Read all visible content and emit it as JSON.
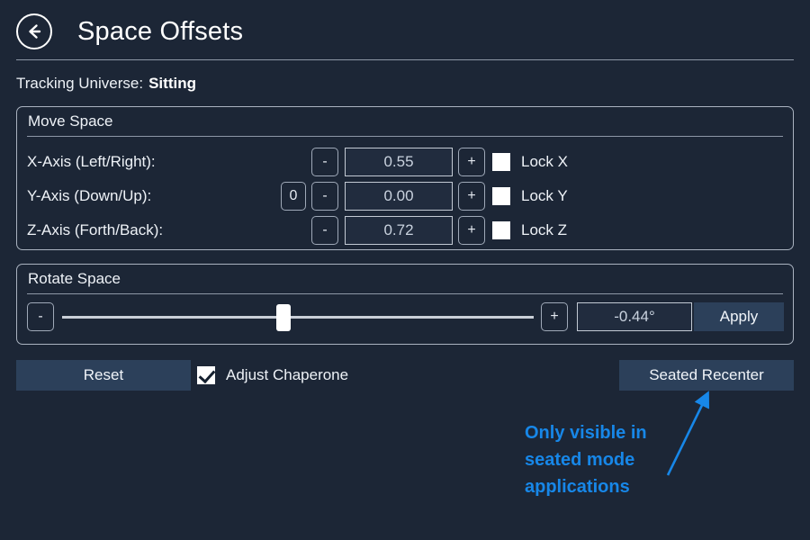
{
  "header": {
    "back_icon": "back-arrow-circle-icon",
    "title": "Space Offsets"
  },
  "tracking_universe": {
    "label": "Tracking Universe:",
    "value": "Sitting"
  },
  "move_space": {
    "title": "Move Space",
    "rows": [
      {
        "label": "X-Axis (Left/Right):",
        "zero": "",
        "minus": "-",
        "value": "0.55",
        "plus": "+",
        "lock_label": "Lock X",
        "locked": false
      },
      {
        "label": "Y-Axis (Down/Up):",
        "zero": "0",
        "minus": "-",
        "value": "0.00",
        "plus": "+",
        "lock_label": "Lock Y",
        "locked": false
      },
      {
        "label": "Z-Axis (Forth/Back):",
        "zero": "",
        "minus": "-",
        "value": "0.72",
        "plus": "+",
        "lock_label": "Lock Z",
        "locked": false
      }
    ]
  },
  "rotate_space": {
    "title": "Rotate Space",
    "minus": "-",
    "plus": "+",
    "slider_percent": 47,
    "value": "-0.44°",
    "apply_label": "Apply"
  },
  "bottom_bar": {
    "reset_label": "Reset",
    "adjust_chaperone_label": "Adjust Chaperone",
    "adjust_chaperone_checked": true,
    "seated_recenter_label": "Seated Recenter"
  },
  "annotation": {
    "text": "Only visible in seated mode applications",
    "color": "#1787e8"
  },
  "colors": {
    "background": "#1c2636",
    "panel_border": "#aab3c0",
    "field_border": "#c3cad4",
    "button_fill": "#2c405a",
    "text": "#eef2f7",
    "accent_blue": "#1787e8"
  }
}
